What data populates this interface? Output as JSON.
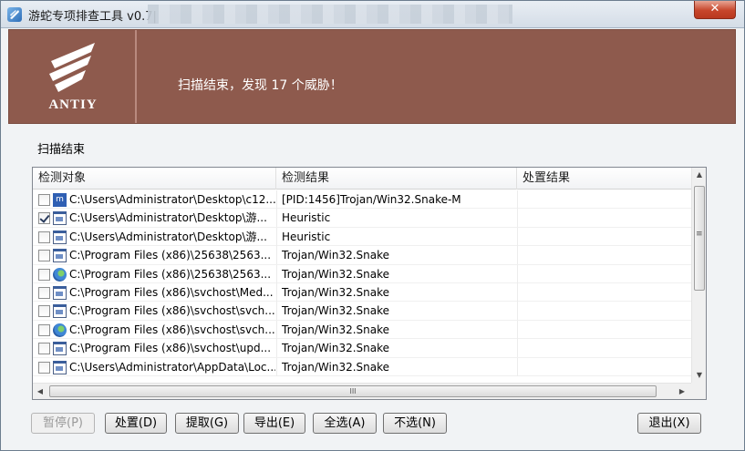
{
  "window": {
    "title": "游蛇专项排查工具 v0.7|",
    "close_glyph": "✕"
  },
  "banner": {
    "logo_text": "ANTIY",
    "message": "扫描结束，发现 17 个威胁！"
  },
  "section_label": "扫描结束",
  "list": {
    "columns": [
      "检测对象",
      "检测结果",
      "处置结果"
    ],
    "rows": [
      {
        "checked": false,
        "icon": "m-file-icon",
        "object": "C:\\Users\\Administrator\\Desktop\\c12...",
        "result": "[PID:1456]Trojan/Win32.Snake-M",
        "action": ""
      },
      {
        "checked": true,
        "icon": "exe-icon",
        "object": "C:\\Users\\Administrator\\Desktop\\游...",
        "result": "Heuristic",
        "action": ""
      },
      {
        "checked": false,
        "icon": "exe-icon",
        "object": "C:\\Users\\Administrator\\Desktop\\游...",
        "result": "Heuristic",
        "action": ""
      },
      {
        "checked": false,
        "icon": "exe-icon",
        "object": "C:\\Program Files (x86)\\25638\\2563...",
        "result": "Trojan/Win32.Snake",
        "action": ""
      },
      {
        "checked": false,
        "icon": "globe-icon",
        "object": "C:\\Program Files (x86)\\25638\\2563...",
        "result": "Trojan/Win32.Snake",
        "action": ""
      },
      {
        "checked": false,
        "icon": "exe-icon",
        "object": "C:\\Program Files (x86)\\svchost\\Med...",
        "result": "Trojan/Win32.Snake",
        "action": ""
      },
      {
        "checked": false,
        "icon": "exe-icon",
        "object": "C:\\Program Files (x86)\\svchost\\svch...",
        "result": "Trojan/Win32.Snake",
        "action": ""
      },
      {
        "checked": false,
        "icon": "globe-icon",
        "object": "C:\\Program Files (x86)\\svchost\\svch...",
        "result": "Trojan/Win32.Snake",
        "action": ""
      },
      {
        "checked": false,
        "icon": "exe-icon",
        "object": "C:\\Program Files (x86)\\svchost\\upd...",
        "result": "Trojan/Win32.Snake",
        "action": ""
      },
      {
        "checked": false,
        "icon": "exe-icon",
        "object": "C:\\Users\\Administrator\\AppData\\Loc...",
        "result": "Trojan/Win32.Snake",
        "action": ""
      }
    ],
    "scroll": {
      "up": "▲",
      "down": "▼",
      "left": "◀",
      "right": "▶",
      "grip": "III"
    }
  },
  "buttons": {
    "pause": "暂停(P)",
    "handle": "处置(D)",
    "extract": "提取(G)",
    "export": "导出(E)",
    "select_all": "全选(A)",
    "select_none": "不选(N)",
    "exit": "退出(X)"
  }
}
